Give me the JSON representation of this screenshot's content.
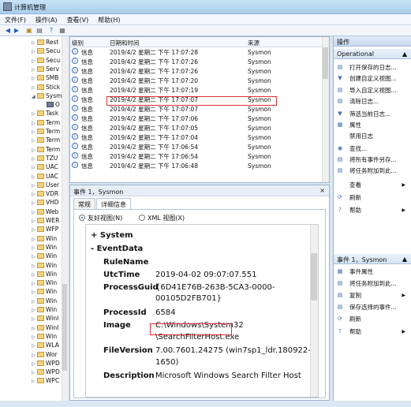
{
  "window": {
    "title": "计算机管理"
  },
  "menu": [
    "文件(F)",
    "操作(A)",
    "查看(V)",
    "帮助(H)"
  ],
  "tree": {
    "items": [
      "Rest",
      "Secu",
      "Secu",
      "Serv",
      "SMB",
      "Stick",
      "Sysm",
      "O",
      "Task",
      "Term",
      "Term",
      "Term",
      "Term",
      "TZU",
      "UAC",
      "UAC",
      "User",
      "VDR",
      "VHD",
      "Web",
      "WER",
      "WFP",
      "Win",
      "Win",
      "Win",
      "Win",
      "Win",
      "Win",
      "Win",
      "Win",
      "Win",
      "WinI",
      "WinI",
      "Win",
      "WLA",
      "Wor",
      "WPD",
      "WPD",
      "WPC"
    ]
  },
  "list": {
    "columns": [
      "级别",
      "日期和时间",
      "来源"
    ],
    "rows": [
      {
        "level": "信息",
        "datetime": "2019/4/2 星期二 下午 17:07:28",
        "source": "Sysmon"
      },
      {
        "level": "信息",
        "datetime": "2019/4/2 星期二 下午 17:07:26",
        "source": "Sysmon"
      },
      {
        "level": "信息",
        "datetime": "2019/4/2 星期二 下午 17:07:26",
        "source": "Sysmon"
      },
      {
        "level": "信息",
        "datetime": "2019/4/2 星期二 下午 17:07:20",
        "source": "Sysmon"
      },
      {
        "level": "信息",
        "datetime": "2019/4/2 星期二 下午 17:07:19",
        "source": "Sysmon"
      },
      {
        "level": "信息",
        "datetime": "2019/4/2 星期二 下午 17:07:07",
        "source": "Sysmon"
      },
      {
        "level": "信息",
        "datetime": "2019/4/2 星期二 下午 17:07:07",
        "source": "Sysmon"
      },
      {
        "level": "信息",
        "datetime": "2019/4/2 星期二 下午 17:07:06",
        "source": "Sysmon"
      },
      {
        "level": "信息",
        "datetime": "2019/4/2 星期二 下午 17:07:05",
        "source": "Sysmon"
      },
      {
        "level": "信息",
        "datetime": "2019/4/2 星期二 下午 17:07:04",
        "source": "Sysmon"
      },
      {
        "level": "信息",
        "datetime": "2019/4/2 星期二 下午 17:06:54",
        "source": "Sysmon"
      },
      {
        "level": "信息",
        "datetime": "2019/4/2 星期二 下午 17:06:54",
        "source": "Sysmon"
      },
      {
        "level": "信息",
        "datetime": "2019/4/2 星期二 下午 17:06:48",
        "source": "Sysmon"
      }
    ]
  },
  "detail": {
    "header": "事件 1，Sysmon",
    "close": "×",
    "tabs": [
      "常规",
      "详细信息"
    ],
    "view_friendly": "友好视图(N)",
    "view_xml": "XML 视图(X)",
    "system": "+ System",
    "eventdata": "- EventData",
    "fields": {
      "rulename": "RuleName",
      "utctime_k": "UtcTime",
      "utctime_v": "2019-04-02 09:07:07.551",
      "guid_k": "ProcessGuid",
      "guid_v1": "{6D41E76B-263B-5CA3-0000-",
      "guid_v2": "00105D2FB701}",
      "pid_k": "ProcessId",
      "pid_v": "6584",
      "image_k": "Image",
      "image_v1": "C:\\Windows\\System32",
      "image_v2": "\\SearchFilterHost.exe",
      "fv_k": "FileVersion",
      "fv_v1": "7.00.7601.24275 (win7sp1_ldr.180922-",
      "fv_v2": "1650)",
      "desc_k": "Description",
      "desc_v": "Microsoft Windows Search Filter Host"
    }
  },
  "actions": {
    "header1": "操作",
    "sub1": "Operational",
    "items1": [
      "打开保存的日志...",
      "创建自定义视图...",
      "导入自定义视图...",
      "清除日志...",
      "筛选当前日志...",
      "属性",
      "禁用日志",
      "查找...",
      "将所有事件另存...",
      "将任务附加到此...",
      "查看",
      "刷新",
      "帮助"
    ],
    "header2": "事件 1，Sysmon",
    "items2": [
      "事件属性",
      "将任务附加到此...",
      "复制",
      "保存选择的事件...",
      "刷新",
      "帮助"
    ]
  }
}
